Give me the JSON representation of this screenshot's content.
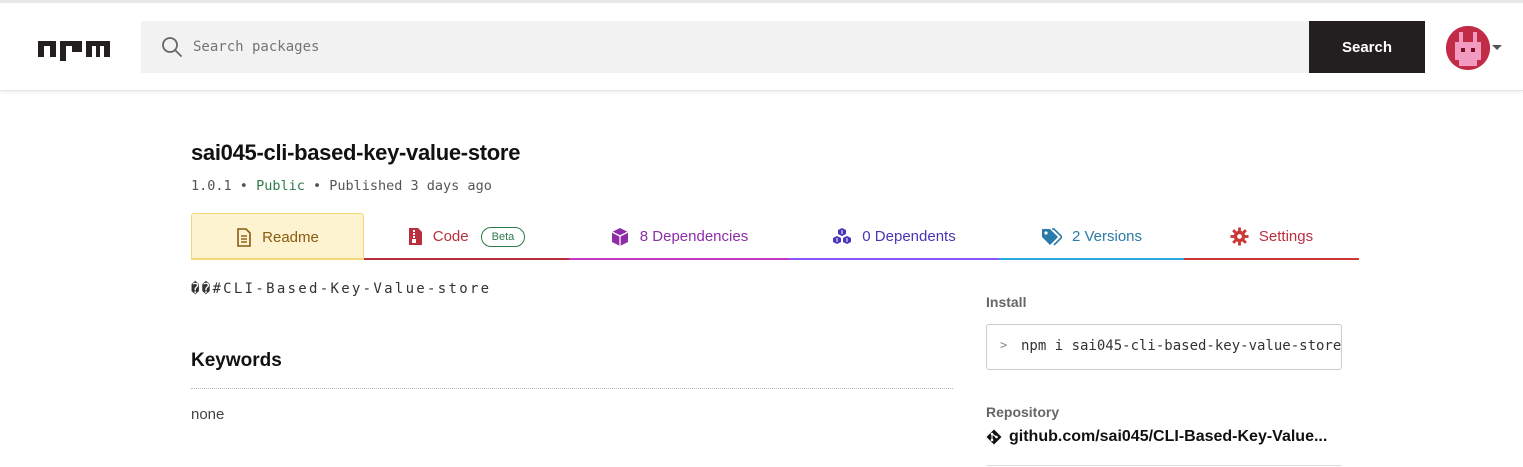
{
  "header": {
    "logo_text": "npm",
    "search_placeholder": "Search packages",
    "search_button_label": "Search",
    "search_icon": "search-icon",
    "avatar_icon": "user-avatar"
  },
  "package": {
    "name": "sai045-cli-based-key-value-store",
    "version": "1.0.1",
    "visibility": "Public",
    "published": "Published 3 days ago",
    "separator": "•"
  },
  "tabs": [
    {
      "label": "Readme",
      "icon": "document-icon",
      "selected": true
    },
    {
      "label": "Code",
      "icon": "file-code-icon",
      "badge": "Beta"
    },
    {
      "label": "8 Dependencies",
      "icon": "box-icon"
    },
    {
      "label": "0 Dependents",
      "icon": "boxes-icon"
    },
    {
      "label": "2 Versions",
      "icon": "tags-icon"
    },
    {
      "label": "Settings",
      "icon": "gear-icon"
    }
  ],
  "readme": {
    "content": "��#CLI-Based-Key-Value-store",
    "keywords_heading": "Keywords",
    "keywords_value": "none"
  },
  "sidebar": {
    "install_label": "Install",
    "install_prompt": ">",
    "install_command": "npm i sai045-cli-based-key-value-store",
    "repository_label": "Repository",
    "repository_link": "github.com/sai045/CLI-Based-Key-Value..."
  },
  "colors": {
    "readme_tab": "#8a5b10",
    "code_tab": "#bb2e3e",
    "dependencies_tab": "#8d2da7",
    "dependents_tab": "#4934ba",
    "versions_tab": "#2a7ba8",
    "settings_tab": "#bb2e3e",
    "search_button_bg": "#231f20",
    "public_label": "#2f7a4a"
  }
}
